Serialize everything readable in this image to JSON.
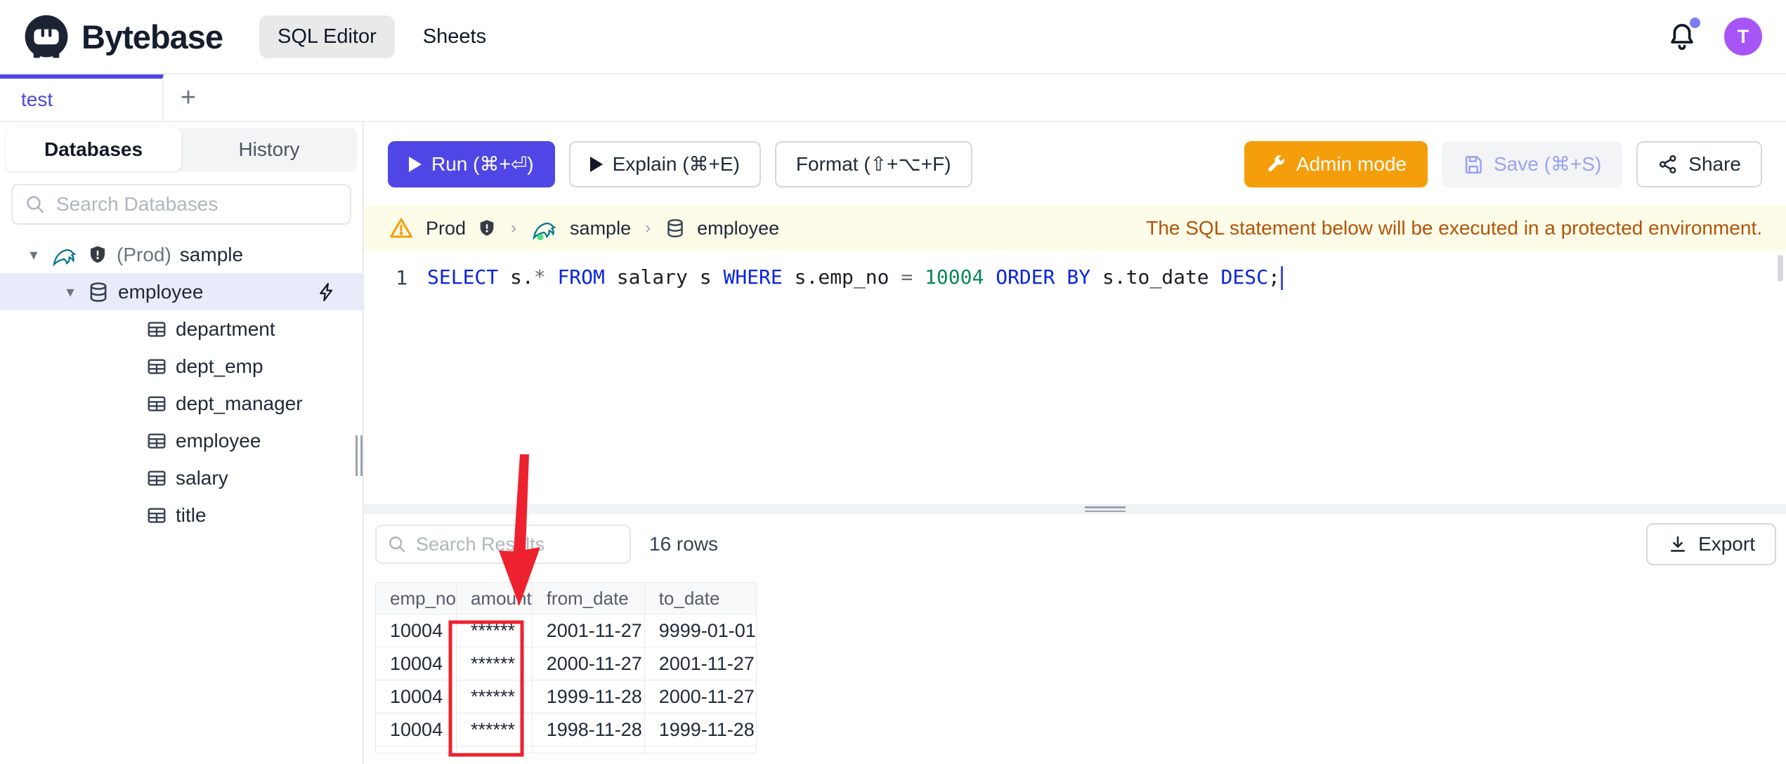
{
  "header": {
    "brand": "Bytebase",
    "nav": [
      {
        "label": "SQL Editor",
        "active": true
      },
      {
        "label": "Sheets",
        "active": false
      }
    ],
    "notifications": {
      "has_unread": true
    },
    "avatar_initial": "T"
  },
  "editor_tabs": {
    "tabs": [
      {
        "label": "test",
        "active": true
      }
    ],
    "add_button": "+"
  },
  "sidebar": {
    "tabs": [
      {
        "label": "Databases",
        "active": true
      },
      {
        "label": "History",
        "active": false
      }
    ],
    "search_placeholder": "Search Databases",
    "tree": {
      "environment_label": "(Prod)",
      "instance_name": "sample",
      "database_name": "employee",
      "tables": [
        "department",
        "dept_emp",
        "dept_manager",
        "employee",
        "salary",
        "title"
      ]
    }
  },
  "toolbar": {
    "run_label": "Run (⌘+⏎)",
    "explain_label": "Explain (⌘+E)",
    "format_label": "Format (⇧+⌥+F)",
    "admin_mode_label": "Admin mode",
    "save_label": "Save (⌘+S)",
    "share_label": "Share"
  },
  "context_bar": {
    "environment": "Prod",
    "database": "sample",
    "table": "employee",
    "notice": "The SQL statement below will be executed in a protected environment."
  },
  "editor": {
    "line_number": "1",
    "sql": "SELECT s.* FROM salary s WHERE s.emp_no = 10004 ORDER BY s.to_date DESC;",
    "tokens": [
      {
        "t": "SELECT",
        "c": "kw"
      },
      {
        "t": " s.",
        "c": "id"
      },
      {
        "t": "*",
        "c": "op"
      },
      {
        "t": " ",
        "c": "id"
      },
      {
        "t": "FROM",
        "c": "kw"
      },
      {
        "t": " salary s ",
        "c": "id"
      },
      {
        "t": "WHERE",
        "c": "kw"
      },
      {
        "t": " s.emp_no ",
        "c": "id"
      },
      {
        "t": "=",
        "c": "op"
      },
      {
        "t": " ",
        "c": "id"
      },
      {
        "t": "10004",
        "c": "num"
      },
      {
        "t": " ",
        "c": "id"
      },
      {
        "t": "ORDER BY",
        "c": "kw"
      },
      {
        "t": " s.to_date ",
        "c": "id"
      },
      {
        "t": "DESC",
        "c": "kw"
      },
      {
        "t": ";",
        "c": "id"
      }
    ]
  },
  "results": {
    "search_placeholder": "Search Results",
    "row_count": "16 rows",
    "export_label": "Export",
    "table": {
      "columns": [
        "emp_no",
        "amount",
        "from_date",
        "to_date"
      ],
      "rows": [
        [
          "10004",
          "******",
          "2001-11-27",
          "9999-01-01"
        ],
        [
          "10004",
          "******",
          "2000-11-27",
          "2001-11-27"
        ],
        [
          "10004",
          "******",
          "1999-11-28",
          "2000-11-27"
        ],
        [
          "10004",
          "******",
          "1998-11-28",
          "1999-11-28"
        ]
      ],
      "masked_column": "amount"
    }
  },
  "colors": {
    "accent": "#4f46e5",
    "admin_orange": "#f59e0b",
    "annotation_red": "#ee212e",
    "avatar_purple": "#a855f7",
    "notice_text": "#b45309",
    "keyword_blue": "#0b24e0",
    "number_green": "#098658"
  }
}
